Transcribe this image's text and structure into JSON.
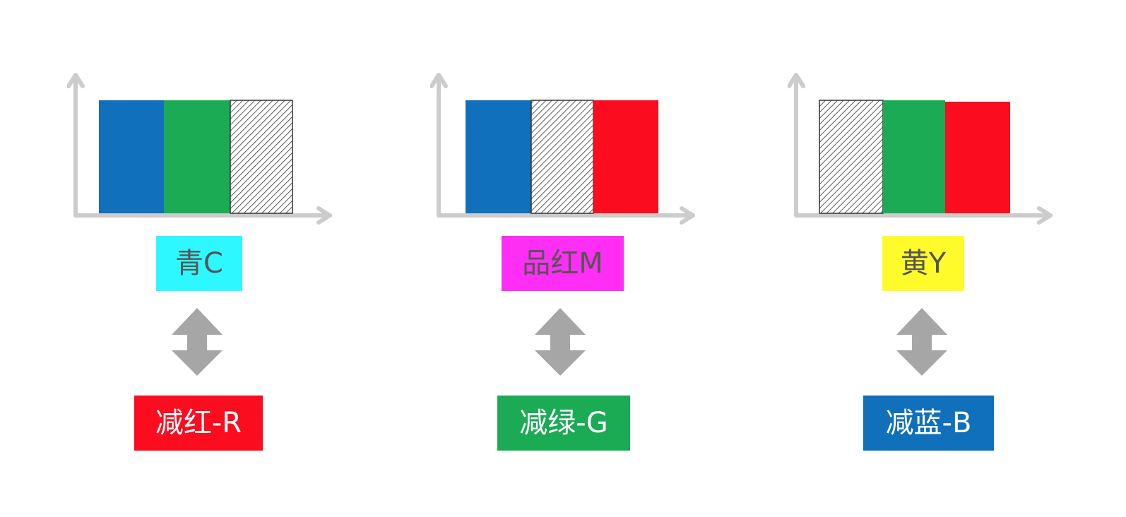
{
  "colors": {
    "blue": "#1170bb",
    "green": "#1bab55",
    "red": "#fb0c1e",
    "hatch": "#333333",
    "axis": "#cccccc",
    "arrow": "#a6a6a6"
  },
  "panels": [
    {
      "label": "青C",
      "label_color": "#2ef8ff",
      "bars": [
        "blue",
        "green",
        "hatch"
      ],
      "subtractive": "减红-R",
      "subtractive_color": "#fb0c1e"
    },
    {
      "label": "品红M",
      "label_color": "#ff2ef4",
      "bars": [
        "blue",
        "hatch",
        "red"
      ],
      "subtractive": "减绿-G",
      "subtractive_color": "#1bab55"
    },
    {
      "label": "黄Y",
      "label_color": "#fffb2b",
      "bars": [
        "hatch",
        "green",
        "red"
      ],
      "subtractive": "减蓝-B",
      "subtractive_color": "#1170bb"
    }
  ]
}
